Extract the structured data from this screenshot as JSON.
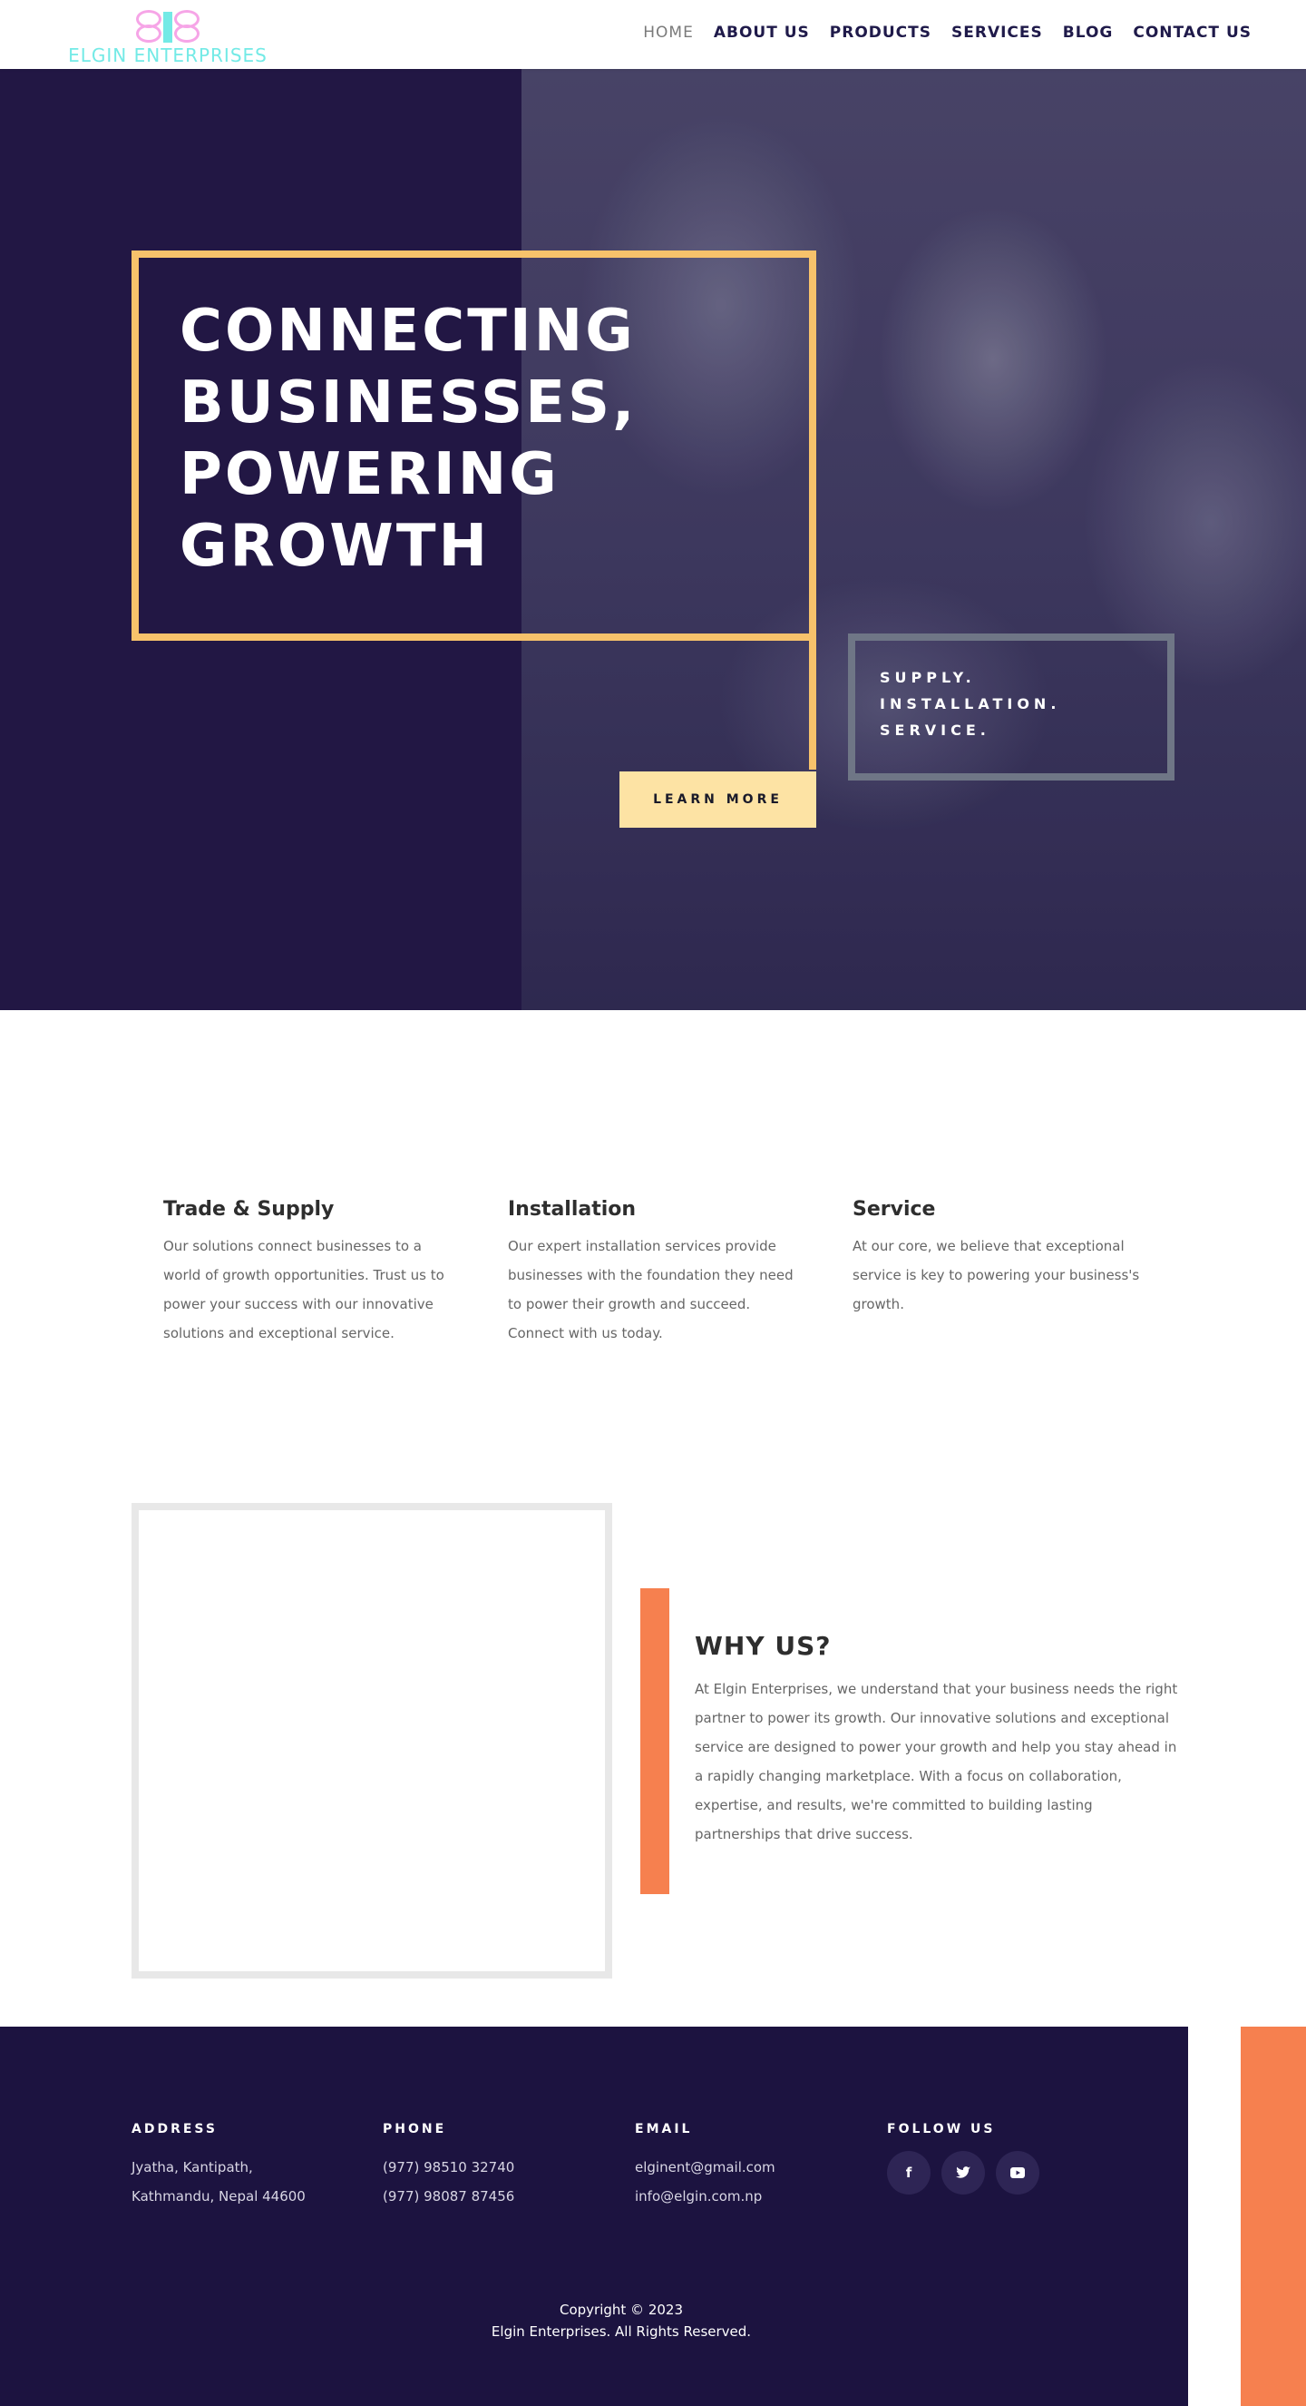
{
  "logo": {
    "text": "ELGIN ENTERPRISES"
  },
  "nav": [
    {
      "label": "HOME",
      "active": true
    },
    {
      "label": "ABOUT US"
    },
    {
      "label": "PRODUCTS"
    },
    {
      "label": "SERVICES"
    },
    {
      "label": "BLOG"
    },
    {
      "label": "CONTACT US"
    }
  ],
  "hero": {
    "title_lines": [
      "CONNECTING",
      "BUSINESSES,",
      "POWERING",
      "GROWTH"
    ],
    "tagline": [
      "SUPPLY.",
      "INSTALLATION.",
      "SERVICE."
    ],
    "button": "LEARN MORE"
  },
  "features": [
    {
      "title": "Trade & Supply",
      "text": "Our solutions connect businesses to a world of growth opportunities. Trust us to power your success with our innovative solutions and exceptional service."
    },
    {
      "title": "Installation",
      "text": "Our expert installation services provide businesses with the foundation they need to power their growth and succeed. Connect with us today."
    },
    {
      "title": "Service",
      "text": "At our core, we believe that exceptional service is key to powering your business's growth."
    }
  ],
  "why": {
    "title": "WHY US?",
    "text": "At Elgin Enterprises, we understand that your business needs the right partner to power its growth. Our innovative solutions and exceptional service are designed to power your growth and help you stay ahead in a rapidly changing marketplace. With a focus on collaboration, expertise, and results, we're committed to building lasting partnerships that drive success."
  },
  "footer": {
    "address": {
      "heading": "ADDRESS",
      "lines": [
        "Jyatha, Kantipath,",
        "Kathmandu, Nepal 44600"
      ]
    },
    "phone": {
      "heading": "PHONE",
      "lines": [
        "(977) 98510 32740",
        "(977) 98087 87456"
      ]
    },
    "email": {
      "heading": "EMAIL",
      "lines": [
        "elginent@gmail.com",
        "info@elgin.com.np"
      ]
    },
    "follow": {
      "heading": "FOLLOW US",
      "icons": [
        "facebook-icon",
        "twitter-icon",
        "youtube-icon"
      ]
    },
    "copyright": [
      "Copyright © 2023",
      "Elgin Enterprises. All Rights Reserved."
    ]
  },
  "colors": {
    "navy": "#221744",
    "footer_navy": "#1c1340",
    "gold": "#f7c26b",
    "button_cream": "#fde3a4",
    "orange": "#f6804f",
    "logo_cyan": "#73eae6",
    "logo_pink": "#f6a5e7"
  }
}
